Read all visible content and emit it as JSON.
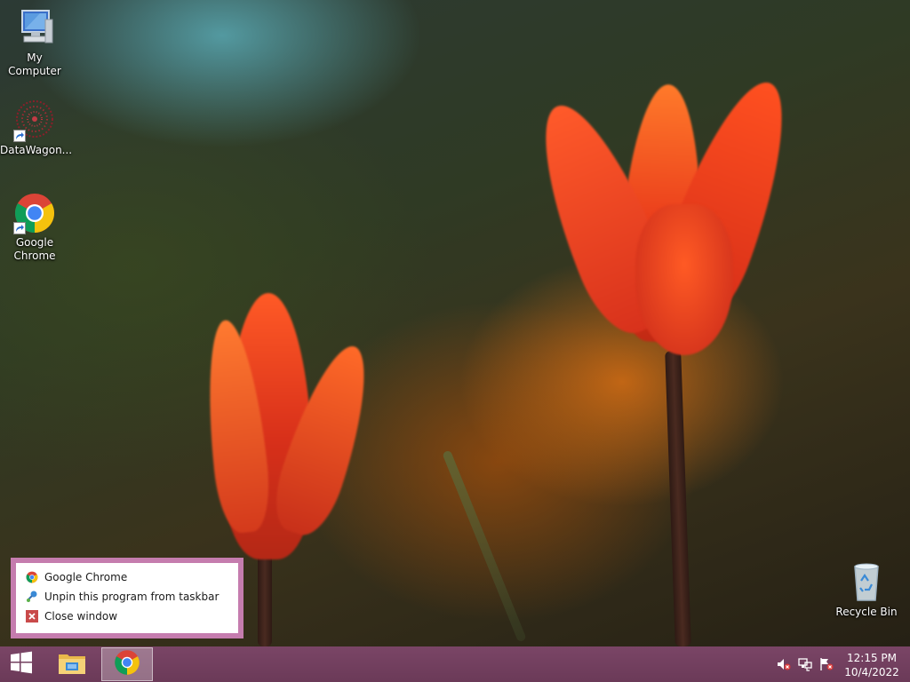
{
  "desktop": {
    "icons": [
      {
        "label": "My Computer",
        "icon": "computer-icon"
      },
      {
        "label": "DataWagon...",
        "icon": "datawagon-icon"
      },
      {
        "label": "Google Chrome",
        "icon": "chrome-icon"
      },
      {
        "label": "Recycle Bin",
        "icon": "recycle-bin-icon"
      }
    ]
  },
  "jumplist": {
    "items": [
      {
        "label": "Google Chrome",
        "icon": "chrome-icon"
      },
      {
        "label": "Unpin this program from taskbar",
        "icon": "unpin-icon"
      },
      {
        "label": "Close window",
        "icon": "close-icon"
      }
    ]
  },
  "taskbar": {
    "start_icon": "windows-logo-icon",
    "pinned": [
      {
        "name": "File Explorer",
        "icon": "file-explorer-icon"
      },
      {
        "name": "Google Chrome",
        "icon": "chrome-icon",
        "active": true
      }
    ],
    "tray": [
      "volume-muted-icon",
      "network-icon",
      "action-center-flag-icon"
    ],
    "clock": {
      "time": "12:15 PM",
      "date": "10/4/2022"
    }
  },
  "colors": {
    "taskbar": "#6b3a58",
    "jumplist_border": "#c57cae"
  }
}
